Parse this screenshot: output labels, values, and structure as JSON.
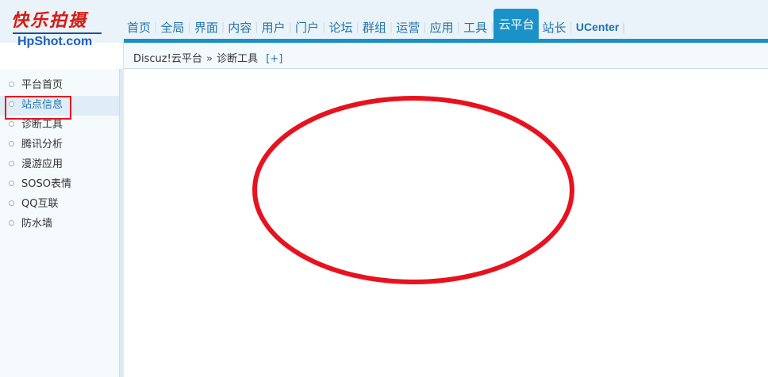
{
  "logo": {
    "title": "快乐拍摄",
    "subtitle": "HpShot.com"
  },
  "nav": {
    "items": [
      {
        "label": "首页",
        "active": false
      },
      {
        "label": "全局",
        "active": false
      },
      {
        "label": "界面",
        "active": false
      },
      {
        "label": "内容",
        "active": false
      },
      {
        "label": "用户",
        "active": false
      },
      {
        "label": "门户",
        "active": false
      },
      {
        "label": "论坛",
        "active": false
      },
      {
        "label": "群组",
        "active": false
      },
      {
        "label": "运营",
        "active": false
      },
      {
        "label": "应用",
        "active": false
      },
      {
        "label": "工具",
        "active": false
      },
      {
        "label": "云平台",
        "active": true
      },
      {
        "label": "站长",
        "active": false
      },
      {
        "label": "UCenter",
        "active": false
      }
    ]
  },
  "breadcrumb": {
    "root": "Discuz!云平台",
    "separator": "»",
    "current": "诊断工具",
    "add_label": "[+]"
  },
  "sidebar": {
    "items": [
      {
        "label": "平台首页"
      },
      {
        "label": "站点信息"
      },
      {
        "label": "诊断工具"
      },
      {
        "label": "腾讯分析"
      },
      {
        "label": "漫游应用"
      },
      {
        "label": "SOSO表情"
      },
      {
        "label": "QQ互联"
      },
      {
        "label": "防水墙"
      }
    ],
    "active_index": 1
  },
  "colors": {
    "accent": "#1b92c7",
    "link": "#2273ab",
    "annotation": "#e8121f"
  }
}
